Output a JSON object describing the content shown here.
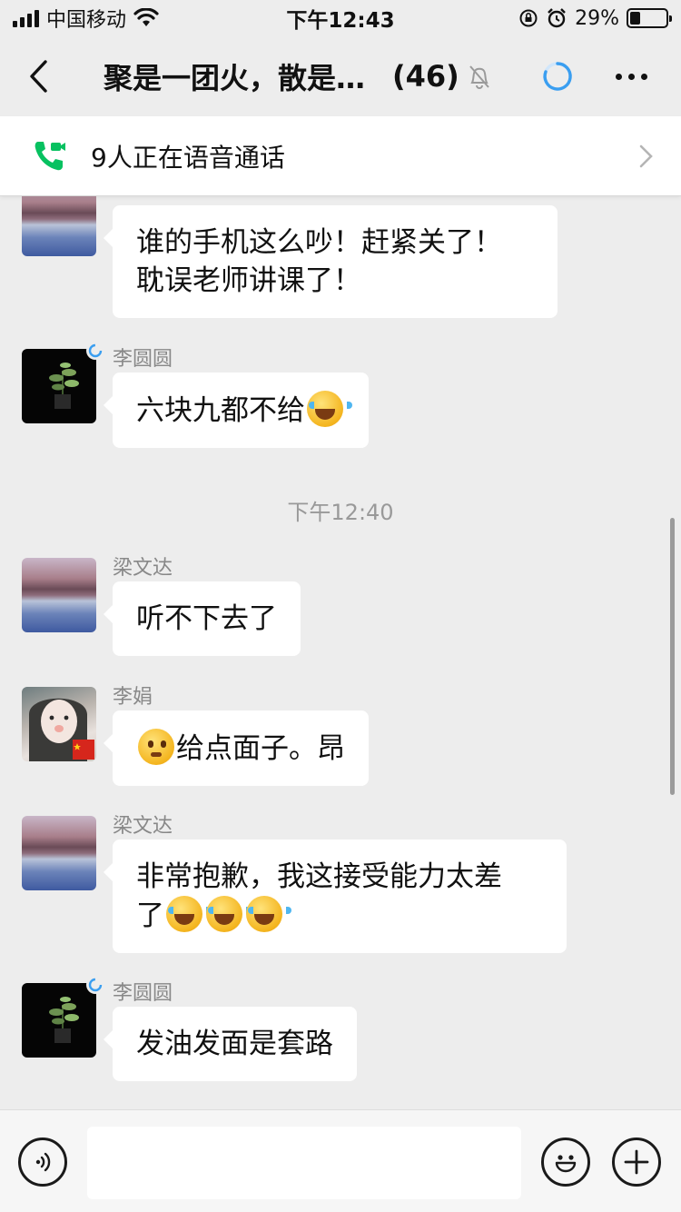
{
  "status_bar": {
    "carrier": "中国移动",
    "time": "下午12:43",
    "battery": "29%",
    "battery_level": 0.29
  },
  "header": {
    "title": "聚是一团火，散是…",
    "member_count": "(46)"
  },
  "call_banner": {
    "text": "9人正在语音通话"
  },
  "messages": [
    {
      "sender": "",
      "text_lines": [
        "谁的手机这么吵！赶紧关了！",
        "耽误老师讲课了！"
      ]
    },
    {
      "sender": "李圆圆",
      "text": "六块九都不给",
      "emoji": "laugh-cry"
    },
    {
      "sender": "梁文达",
      "text": "听不下去了"
    },
    {
      "sender": "李娟",
      "text": "给点面子。昂",
      "emoji": "sheepish"
    },
    {
      "sender": "梁文达",
      "text_lines": [
        "非常抱歉，我这接受能力太差",
        "了"
      ],
      "emoji": "laugh-cry"
    },
    {
      "sender": "李圆圆",
      "text": "发油发面是套路"
    }
  ],
  "time_separator": "下午12:40",
  "input_bar": {
    "placeholder": ""
  },
  "colors": {
    "background": "#ededed",
    "bubble": "#ffffff",
    "call_green": "#07c160",
    "ring_blue": "#3a9ef0"
  }
}
